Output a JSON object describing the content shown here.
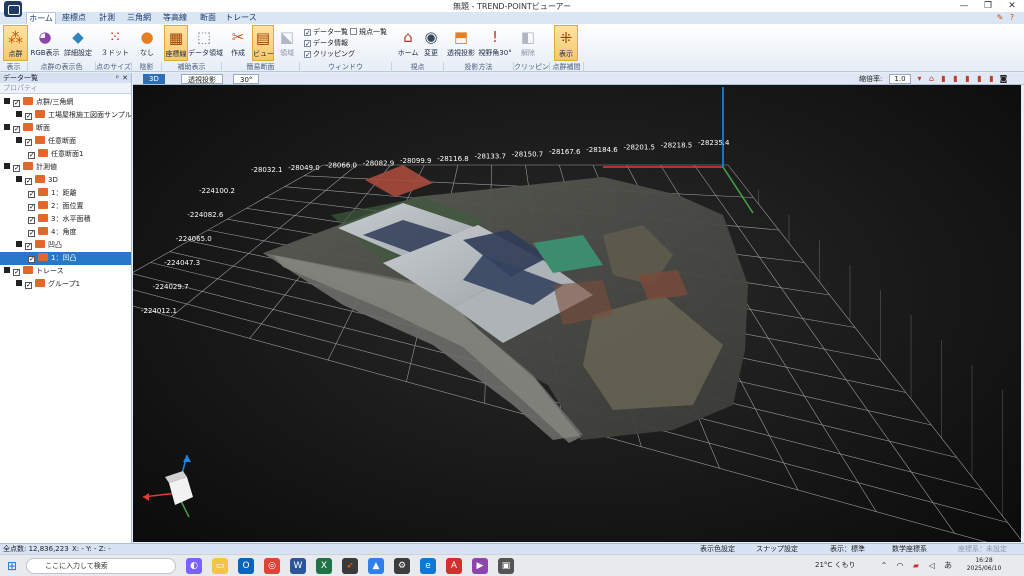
{
  "window": {
    "title": "無題 - TREND-POINTビューアー",
    "minimize": "—",
    "restore": "❐",
    "close": "✕"
  },
  "ribbon_tabs": [
    {
      "label": "ホーム",
      "active": true
    },
    {
      "label": "座標点"
    },
    {
      "label": "計測"
    },
    {
      "label": "三角網"
    },
    {
      "label": "等高線"
    },
    {
      "label": "断面"
    },
    {
      "label": "トレース"
    }
  ],
  "ribbon": {
    "buttons": {
      "point_cloud": "点群",
      "rgb_display": "RGB表示",
      "detail_settings": "詳細設定",
      "dot3": "３ドット",
      "none": "なし",
      "coord_lines": "座標線",
      "data_area": "データ領域",
      "create": "作成",
      "view": "ビュー",
      "area": "領域",
      "home": "ホーム",
      "change": "変更",
      "perspective": "透視投影",
      "fov": "視野角30°",
      "release": "解除",
      "display": "表示"
    },
    "window_checks": {
      "data_list": "データ一覧",
      "data_info": "データ情報",
      "clipping": "クリッピング",
      "point_list": "規点一覧"
    },
    "groups": {
      "display": "表示",
      "pc_color": "点群の表示色",
      "pt_size": "点のサイズ",
      "shading": "陰影",
      "aux_display": "補助表示",
      "simple_section": "簡易断面",
      "window": "ウィンドウ",
      "viewpoint": "視点",
      "projection": "投影方法",
      "clipping": "クリッピング",
      "pc_complement": "点群補間"
    }
  },
  "left_panel": {
    "title": "データ一覧",
    "pin": "ᵖ",
    "close": "✕",
    "toolbar_label": "プロパティ",
    "tree": [
      {
        "label": "点群/三角網",
        "level": 0
      },
      {
        "label": "工場屋根施工図面サンプル",
        "level": 1
      },
      {
        "label": "断面",
        "level": 0
      },
      {
        "label": "任意断面",
        "level": 1
      },
      {
        "label": "任意断面1",
        "level": 2
      },
      {
        "label": "計測値",
        "level": 0
      },
      {
        "label": "3D",
        "level": 1
      },
      {
        "label": "1：距離",
        "level": 2
      },
      {
        "label": "2：面位置",
        "level": 2
      },
      {
        "label": "3：水平面積",
        "level": 2
      },
      {
        "label": "4：角度",
        "level": 2
      },
      {
        "label": "凹凸",
        "level": 1
      },
      {
        "label": "1：凹凸",
        "level": 2,
        "selected": true
      },
      {
        "label": "トレース",
        "level": 0
      },
      {
        "label": "グループ1",
        "level": 1
      }
    ]
  },
  "view_toolbar": {
    "tab_3d": "3D",
    "tab_perspective": "透視投影",
    "tab_angle": "30°",
    "zoom_label": "縮倍率:",
    "zoom_value": "1.0"
  },
  "scene": {
    "x_coords": [
      "-28032.1",
      "-28049.0",
      "-28066.0",
      "-28082.9",
      "-28099.9",
      "-28116.8",
      "-28133.7",
      "-28150.7",
      "-28167.6",
      "-28184.6",
      "-28201.5",
      "-28218.5",
      "-28235.4"
    ],
    "y_coords": [
      "-224100.2",
      "-224082.6",
      "-224065.0",
      "-224047.3",
      "-224029.7",
      "-224012.1"
    ],
    "colors": {
      "x_axis": "#e53935",
      "y_axis": "#43a047",
      "z_axis": "#1e88e5",
      "grid": "#9a9a9a"
    }
  },
  "status": {
    "total_points": "全点数: 12,836,223",
    "coords": "X: - Y: - Z: -",
    "color_settings": "表示色設定",
    "snap_settings": "スナップ設定",
    "display_standard": "表示：標準",
    "math_coords": "数学座標系",
    "coord_system": "座標系：未設定"
  },
  "taskbar": {
    "search_placeholder": "ここに入力して検索",
    "weather": "21°C くもり",
    "time": "16:28",
    "date": "2025/06/10"
  }
}
